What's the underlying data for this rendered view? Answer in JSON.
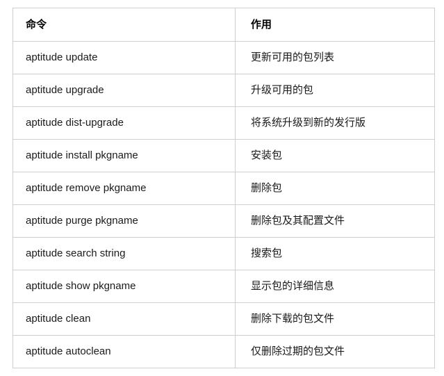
{
  "table": {
    "headers": {
      "command": "命令",
      "effect": "作用"
    },
    "rows": [
      {
        "command": "aptitude update",
        "effect": "更新可用的包列表"
      },
      {
        "command": "aptitude upgrade",
        "effect": "升级可用的包"
      },
      {
        "command": "aptitude dist-upgrade",
        "effect": "将系统升级到新的发行版"
      },
      {
        "command": "aptitude install pkgname",
        "effect": "安装包"
      },
      {
        "command": "aptitude remove pkgname",
        "effect": "删除包"
      },
      {
        "command": "aptitude purge pkgname",
        "effect": "删除包及其配置文件"
      },
      {
        "command": "aptitude search string",
        "effect": "搜索包"
      },
      {
        "command": "aptitude show pkgname",
        "effect": "显示包的详细信息"
      },
      {
        "command": "aptitude clean",
        "effect": "删除下载的包文件"
      },
      {
        "command": "aptitude autoclean",
        "effect": "仅删除过期的包文件"
      }
    ]
  },
  "colors": {
    "border": "#cfcfcf",
    "text": "#1a1a1a",
    "header_text": "#000000",
    "background": "#ffffff"
  }
}
